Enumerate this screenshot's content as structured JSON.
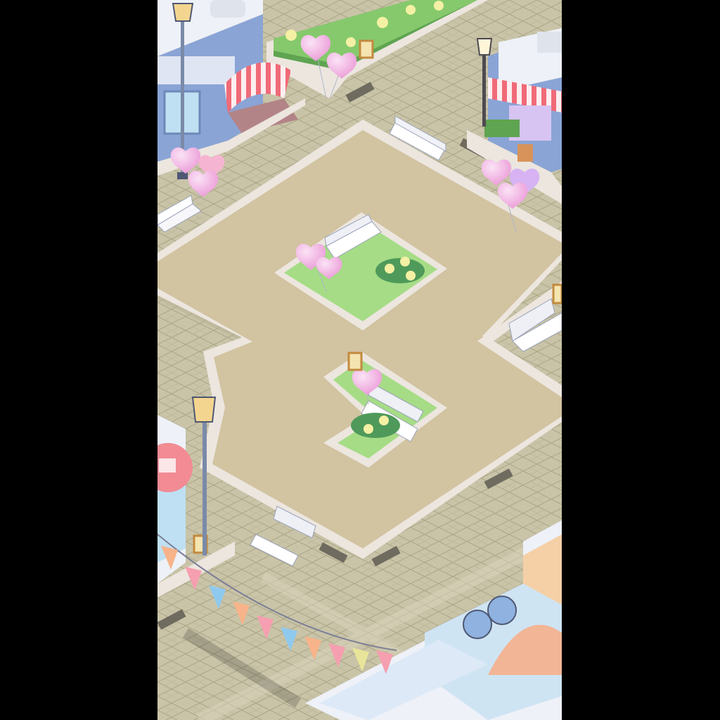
{
  "screen": {
    "type": "isometric town plaza game view",
    "orientation": "portrait"
  },
  "colors": {
    "letterbox": "#000000",
    "cobblestone": "#c9c4a8",
    "cobble_line": "#aaa488",
    "plaza_floor": "#d2c3a1",
    "plaza_border": "#ece6df",
    "grass": "#a6dc86",
    "hedge": "#5fa451",
    "balloon_pink": "#f4a6d8",
    "balloon_lilac": "#dcb4f4",
    "awning_red": "#f06a78",
    "building_white": "#eef1f8",
    "building_blue": "#8aa4d6"
  },
  "scene": {
    "buildings": [
      {
        "id": "cafe-shop-top-left",
        "awning": "striped-red"
      },
      {
        "id": "shop-top-right",
        "awning": "striped-red"
      },
      {
        "id": "gift-shop-left",
        "sign_icon": "gift-flower-icon"
      },
      {
        "id": "food-stall-bottom-right",
        "roof_fans": 2
      }
    ],
    "benches_count": 6,
    "lamp_posts_count": 3,
    "balloon_clusters_count": 5,
    "signboards_count": 4,
    "flower_beds_count": 4,
    "bunting_flags": [
      "#f7b38a",
      "#f59fb0",
      "#8fc9ee",
      "#f7b38a",
      "#f59fb0",
      "#8fc9ee",
      "#f7b38a",
      "#f59fb0",
      "#e8e59a",
      "#f59fb0"
    ]
  }
}
